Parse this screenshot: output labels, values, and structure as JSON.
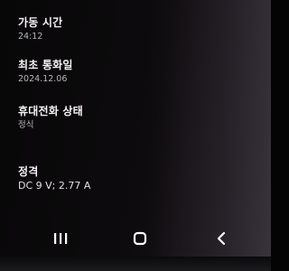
{
  "settings": {
    "uptime": {
      "label": "가동 시간",
      "value": "24:12"
    },
    "last_call": {
      "label": "최초 통화일",
      "value": "2024.12.06"
    },
    "phone_state": {
      "label": "휴대전화 상태",
      "value": "정식"
    },
    "rating": {
      "label": "정격",
      "value": "DC 9 V; 2.77 A"
    }
  },
  "navbar": {
    "recents_icon": "recents-icon",
    "home_icon": "home-icon",
    "back_icon": "back-icon",
    "icon_color": "#ffffff"
  }
}
